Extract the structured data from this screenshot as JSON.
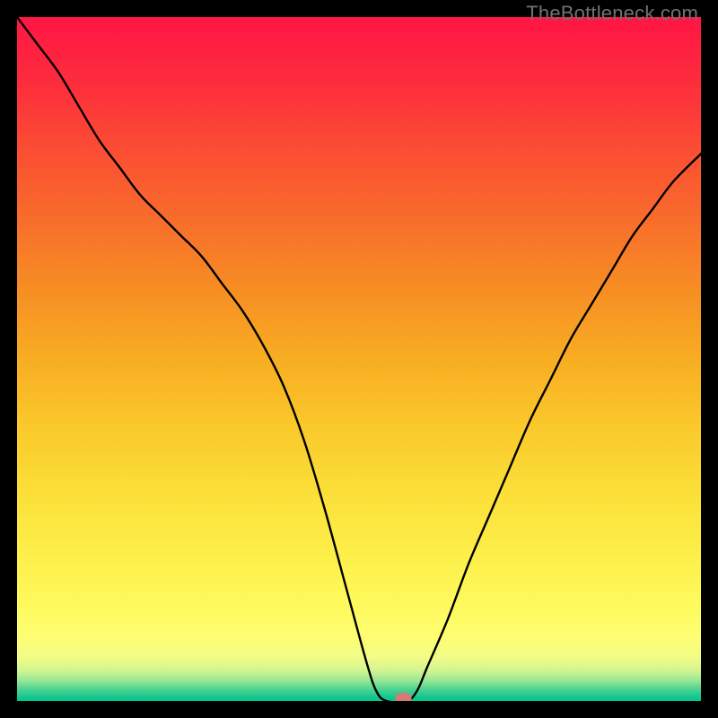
{
  "watermark": "TheBottleneck.com",
  "chart_data": {
    "type": "line",
    "title": "",
    "xlabel": "",
    "ylabel": "",
    "xlim": [
      0,
      100
    ],
    "ylim": [
      0,
      100
    ],
    "grid": false,
    "legend": false,
    "marker": {
      "x": 56.5,
      "y_norm": 0.0,
      "color": "#d57a77"
    },
    "curve_norm": [
      {
        "x": 0.0,
        "y": 1.0
      },
      {
        "x": 3.0,
        "y": 0.96
      },
      {
        "x": 6.0,
        "y": 0.92
      },
      {
        "x": 9.0,
        "y": 0.87
      },
      {
        "x": 12.0,
        "y": 0.82
      },
      {
        "x": 15.0,
        "y": 0.78
      },
      {
        "x": 18.0,
        "y": 0.74
      },
      {
        "x": 21.0,
        "y": 0.71
      },
      {
        "x": 24.0,
        "y": 0.68
      },
      {
        "x": 27.0,
        "y": 0.65
      },
      {
        "x": 30.0,
        "y": 0.61
      },
      {
        "x": 33.0,
        "y": 0.57
      },
      {
        "x": 36.0,
        "y": 0.52
      },
      {
        "x": 39.0,
        "y": 0.46
      },
      {
        "x": 42.0,
        "y": 0.38
      },
      {
        "x": 45.0,
        "y": 0.28
      },
      {
        "x": 48.0,
        "y": 0.17
      },
      {
        "x": 51.0,
        "y": 0.06
      },
      {
        "x": 52.5,
        "y": 0.015
      },
      {
        "x": 54.0,
        "y": 0.0
      },
      {
        "x": 57.0,
        "y": 0.0
      },
      {
        "x": 58.5,
        "y": 0.015
      },
      {
        "x": 60.0,
        "y": 0.05
      },
      {
        "x": 63.0,
        "y": 0.12
      },
      {
        "x": 66.0,
        "y": 0.2
      },
      {
        "x": 69.0,
        "y": 0.27
      },
      {
        "x": 72.0,
        "y": 0.34
      },
      {
        "x": 75.0,
        "y": 0.41
      },
      {
        "x": 78.0,
        "y": 0.47
      },
      {
        "x": 81.0,
        "y": 0.53
      },
      {
        "x": 84.0,
        "y": 0.58
      },
      {
        "x": 87.0,
        "y": 0.63
      },
      {
        "x": 90.0,
        "y": 0.68
      },
      {
        "x": 93.0,
        "y": 0.72
      },
      {
        "x": 96.0,
        "y": 0.76
      },
      {
        "x": 100.0,
        "y": 0.8
      }
    ],
    "gradient_stops": [
      {
        "offset": 0.0,
        "color": "#fe1544"
      },
      {
        "offset": 0.1,
        "color": "#fd2e3c"
      },
      {
        "offset": 0.2,
        "color": "#fb4f33"
      },
      {
        "offset": 0.3,
        "color": "#f86e2b"
      },
      {
        "offset": 0.4,
        "color": "#f78e24"
      },
      {
        "offset": 0.5,
        "color": "#f8ad22"
      },
      {
        "offset": 0.6,
        "color": "#fac92b"
      },
      {
        "offset": 0.7,
        "color": "#fbe039"
      },
      {
        "offset": 0.8,
        "color": "#fdf14c"
      },
      {
        "offset": 0.86,
        "color": "#fefa5d"
      },
      {
        "offset": 0.905,
        "color": "#fefe72"
      },
      {
        "offset": 0.935,
        "color": "#f3fc85"
      },
      {
        "offset": 0.955,
        "color": "#d3f590"
      },
      {
        "offset": 0.97,
        "color": "#99e795"
      },
      {
        "offset": 0.982,
        "color": "#52d592"
      },
      {
        "offset": 0.992,
        "color": "#1fc98f"
      },
      {
        "offset": 1.0,
        "color": "#03c58d"
      }
    ]
  }
}
